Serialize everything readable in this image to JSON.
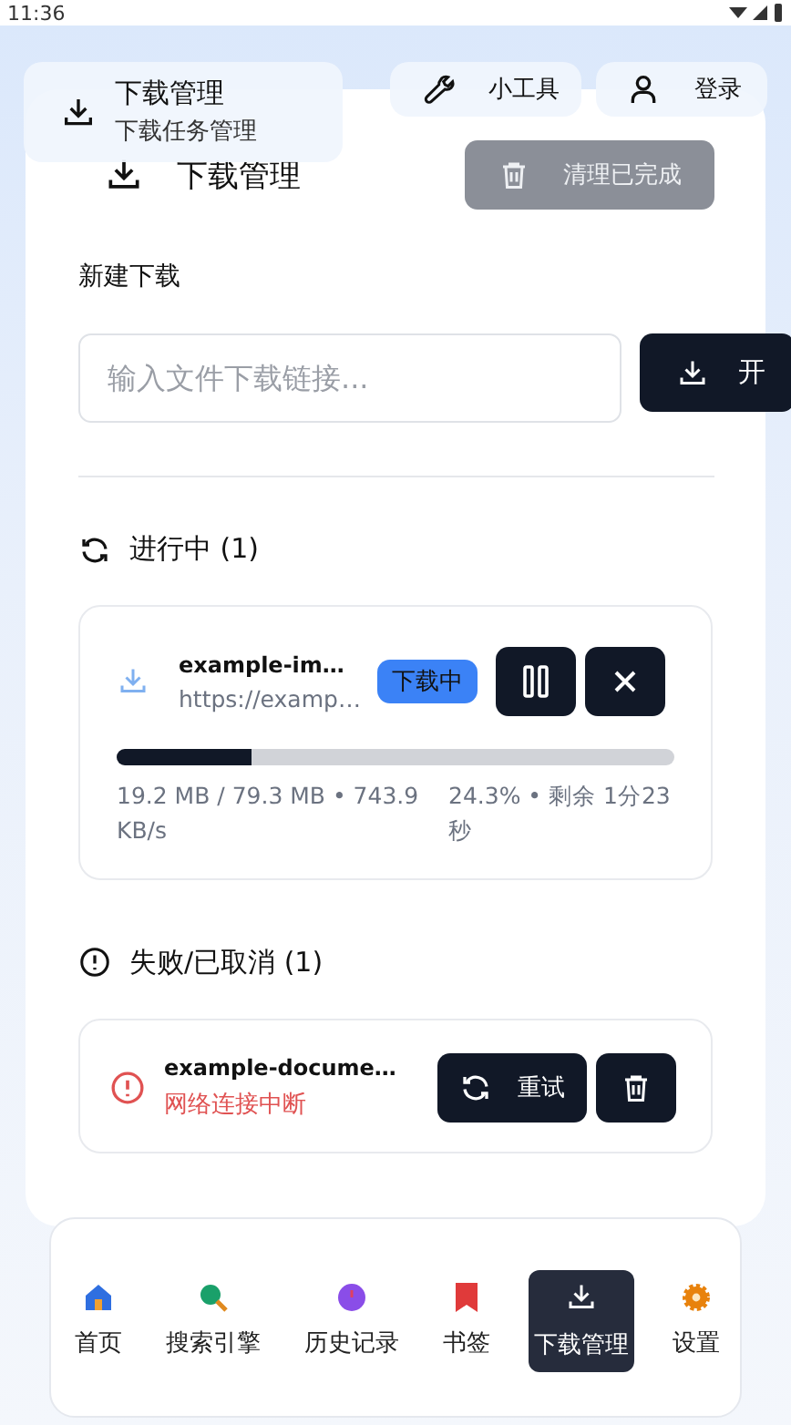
{
  "status_bar": {
    "time": "11:36"
  },
  "header": {
    "title": "下载管理",
    "subtitle": "下载任务管理",
    "buttons": [
      {
        "kind": "tools",
        "label": "小工具"
      },
      {
        "kind": "user",
        "label": "登录"
      }
    ]
  },
  "card": {
    "title": "下载管理",
    "clear_button": {
      "label": "清理已完成",
      "disabled": true
    }
  },
  "new_download": {
    "label": "新建下载",
    "placeholder": "输入文件下载链接...",
    "start_button": "开"
  },
  "active": {
    "title": "进行中 (1)",
    "items": [
      {
        "name": "example-im…",
        "url": "https://examp…",
        "status": "下载中",
        "level": 0.243,
        "size": "19.2 MB / 79.3 MB • 743.9 KB/s",
        "progress": "24.3% • 剩余 1分23秒"
      }
    ]
  },
  "failed": {
    "title": "失败/已取消 (1)",
    "items": [
      {
        "name": "example-docume…",
        "error": "网络连接中断",
        "retry": "重试"
      }
    ]
  },
  "nav": [
    {
      "kind": "home",
      "label": "首页",
      "selected": false
    },
    {
      "kind": "search",
      "label": "搜索引擎",
      "selected": false
    },
    {
      "kind": "history",
      "label": "历史记录",
      "selected": false
    },
    {
      "kind": "bookmark",
      "label": "书签",
      "selected": false
    },
    {
      "kind": "download",
      "label": "下载管理",
      "selected": true
    },
    {
      "kind": "settings",
      "label": "设置",
      "selected": false
    }
  ]
}
